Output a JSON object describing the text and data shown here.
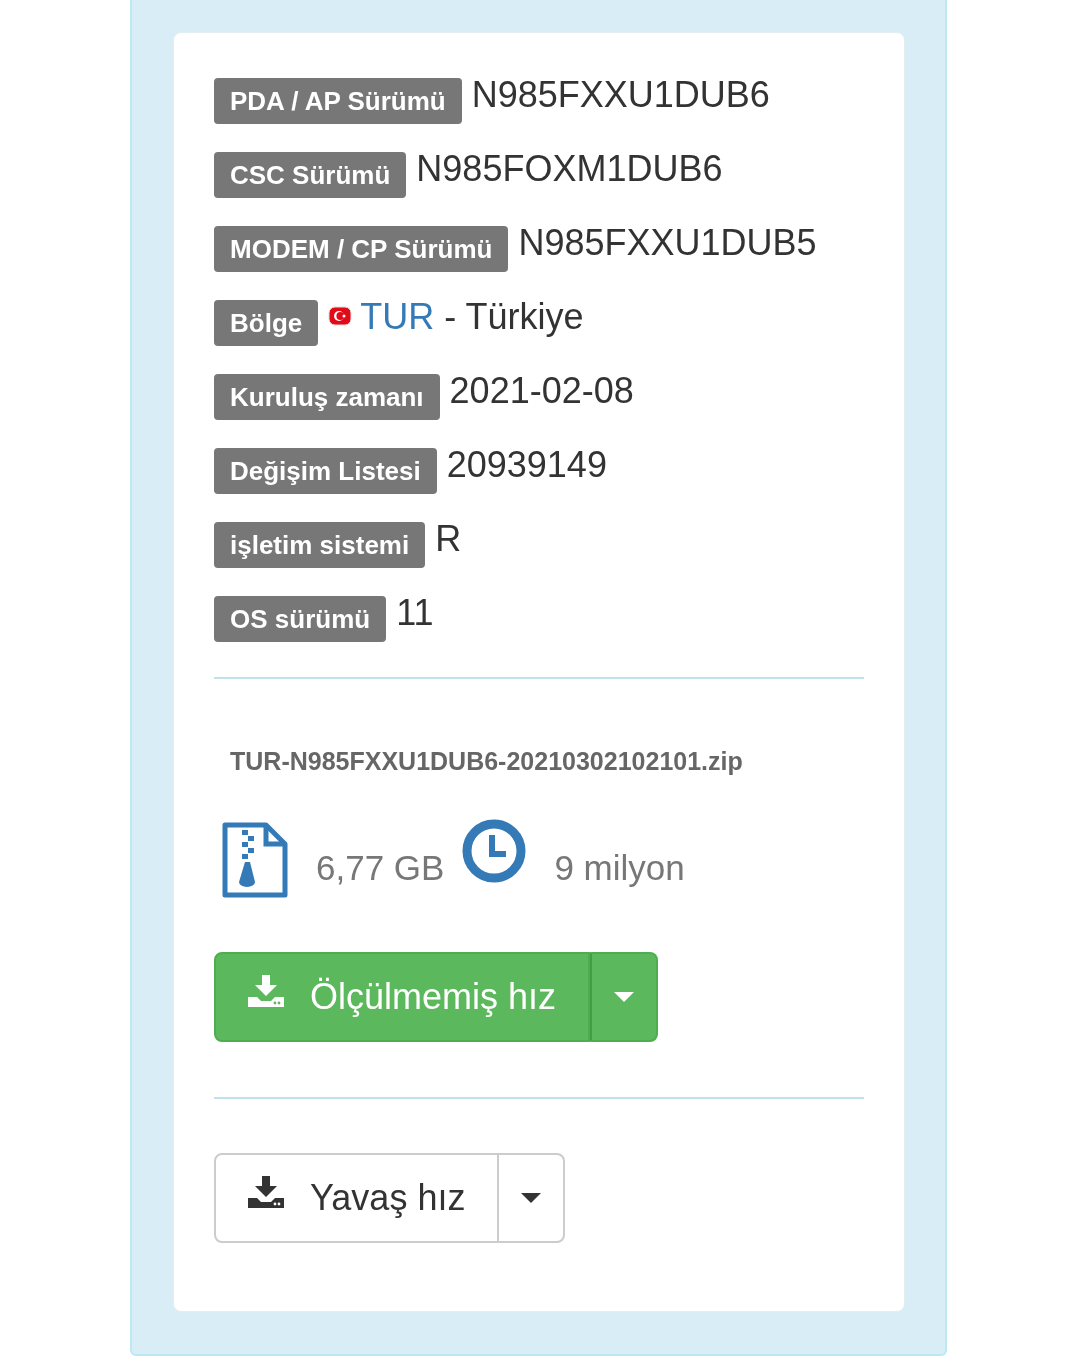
{
  "details": [
    {
      "kind": "text",
      "label": "PDA / AP Sürümü",
      "value": "N985FXXU1DUB6"
    },
    {
      "kind": "text",
      "label": "CSC Sürümü",
      "value": "N985FOXM1DUB6"
    },
    {
      "kind": "text",
      "label": "MODEM / CP Sürümü",
      "value": "N985FXXU1DUB5"
    },
    {
      "kind": "region",
      "label": "Bölge",
      "code": "TUR",
      "value": "- Türkiye"
    },
    {
      "kind": "text",
      "label": "Kuruluş zamanı",
      "value": "2021-02-08"
    },
    {
      "kind": "text",
      "label": "Değişim Listesi",
      "value": "20939149"
    },
    {
      "kind": "text",
      "label": "işletim sistemi",
      "value": "R"
    },
    {
      "kind": "text",
      "label": "OS sürümü",
      "value": "11"
    }
  ],
  "file": {
    "name": "TUR-N985FXXU1DUB6-20210302102101.zip",
    "size": "6,77 GB",
    "downloads": "9 milyon"
  },
  "downloads": [
    {
      "kind": "primary",
      "label": "Ölçülmemiş hız"
    },
    {
      "kind": "default",
      "label": "Yavaş hız"
    }
  ]
}
